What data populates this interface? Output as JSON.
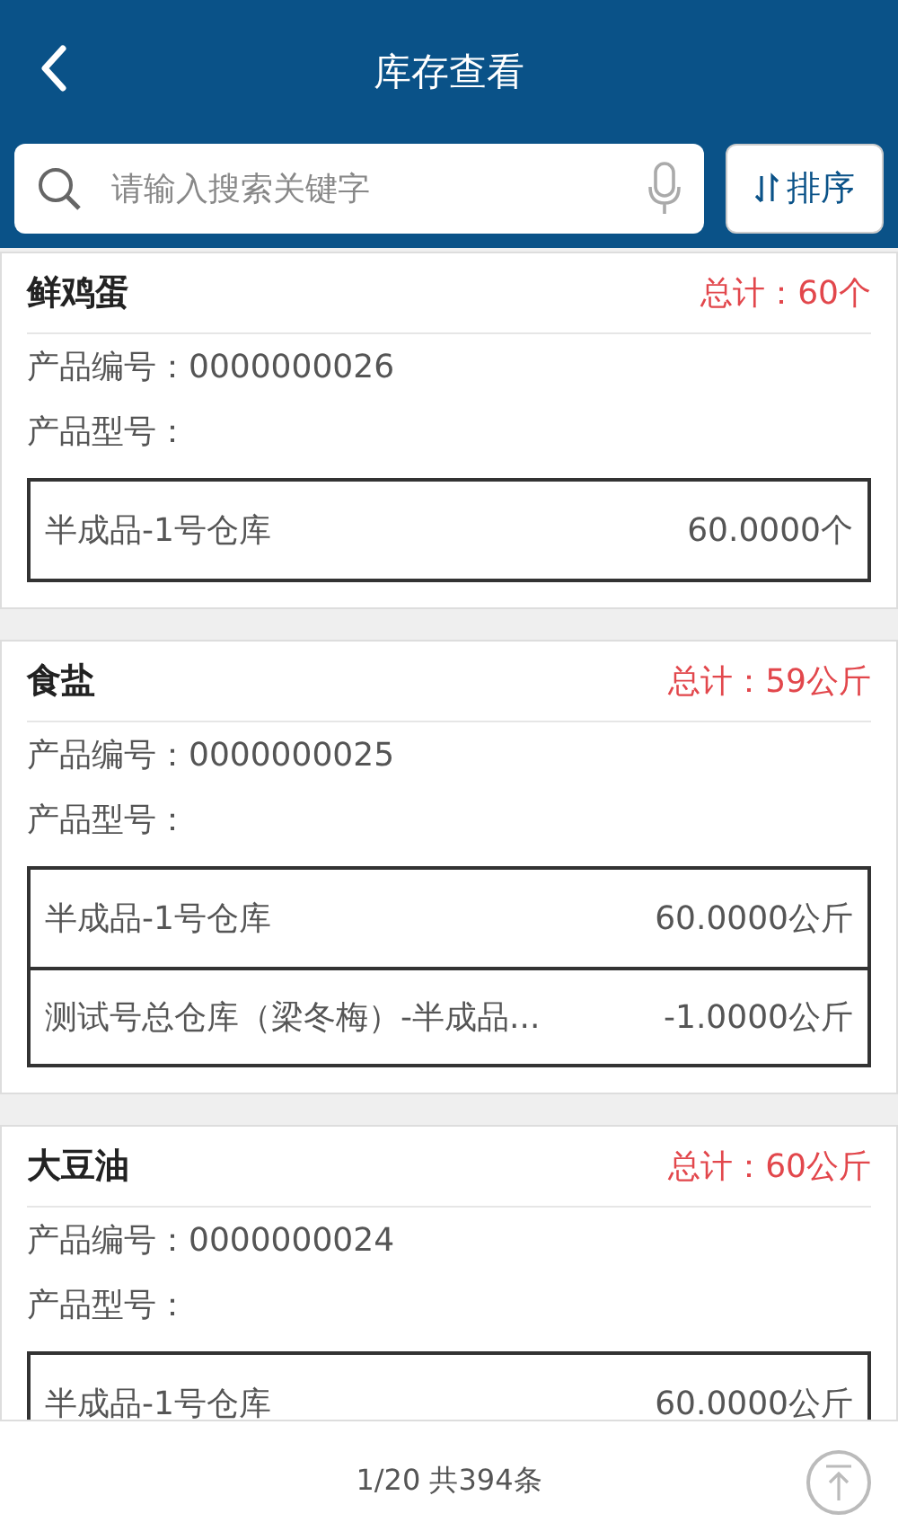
{
  "header": {
    "title": "库存查看"
  },
  "search": {
    "placeholder": "请输入搜索关键字"
  },
  "sort_button": {
    "label": "排序"
  },
  "products": [
    {
      "name": "鲜鸡蛋",
      "total": "总计：60个",
      "fields": [
        {
          "label": "产品编号：",
          "value": "0000000026"
        },
        {
          "label": "产品型号："
        }
      ],
      "stock": [
        {
          "warehouse": "半成品-1号仓库",
          "quantity": "60.0000个"
        }
      ]
    },
    {
      "name": "食盐",
      "total": "总计：59公斤",
      "fields": [
        {
          "label": "产品编号：",
          "value": "0000000025"
        },
        {
          "label": "产品型号："
        }
      ],
      "stock": [
        {
          "warehouse": "半成品-1号仓库",
          "quantity": "60.0000公斤"
        },
        {
          "warehouse": "测试号总仓库（梁冬梅）-半成品...",
          "quantity": "-1.0000公斤"
        }
      ]
    },
    {
      "name": "大豆油",
      "total": "总计：60公斤",
      "fields": [
        {
          "label": "产品编号：",
          "value": "0000000024"
        },
        {
          "label": "产品型号："
        }
      ],
      "stock": [
        {
          "warehouse": "半成品-1号仓库",
          "quantity": "60.0000公斤"
        }
      ]
    }
  ],
  "footer": {
    "pagination": "1/20 共394条"
  }
}
